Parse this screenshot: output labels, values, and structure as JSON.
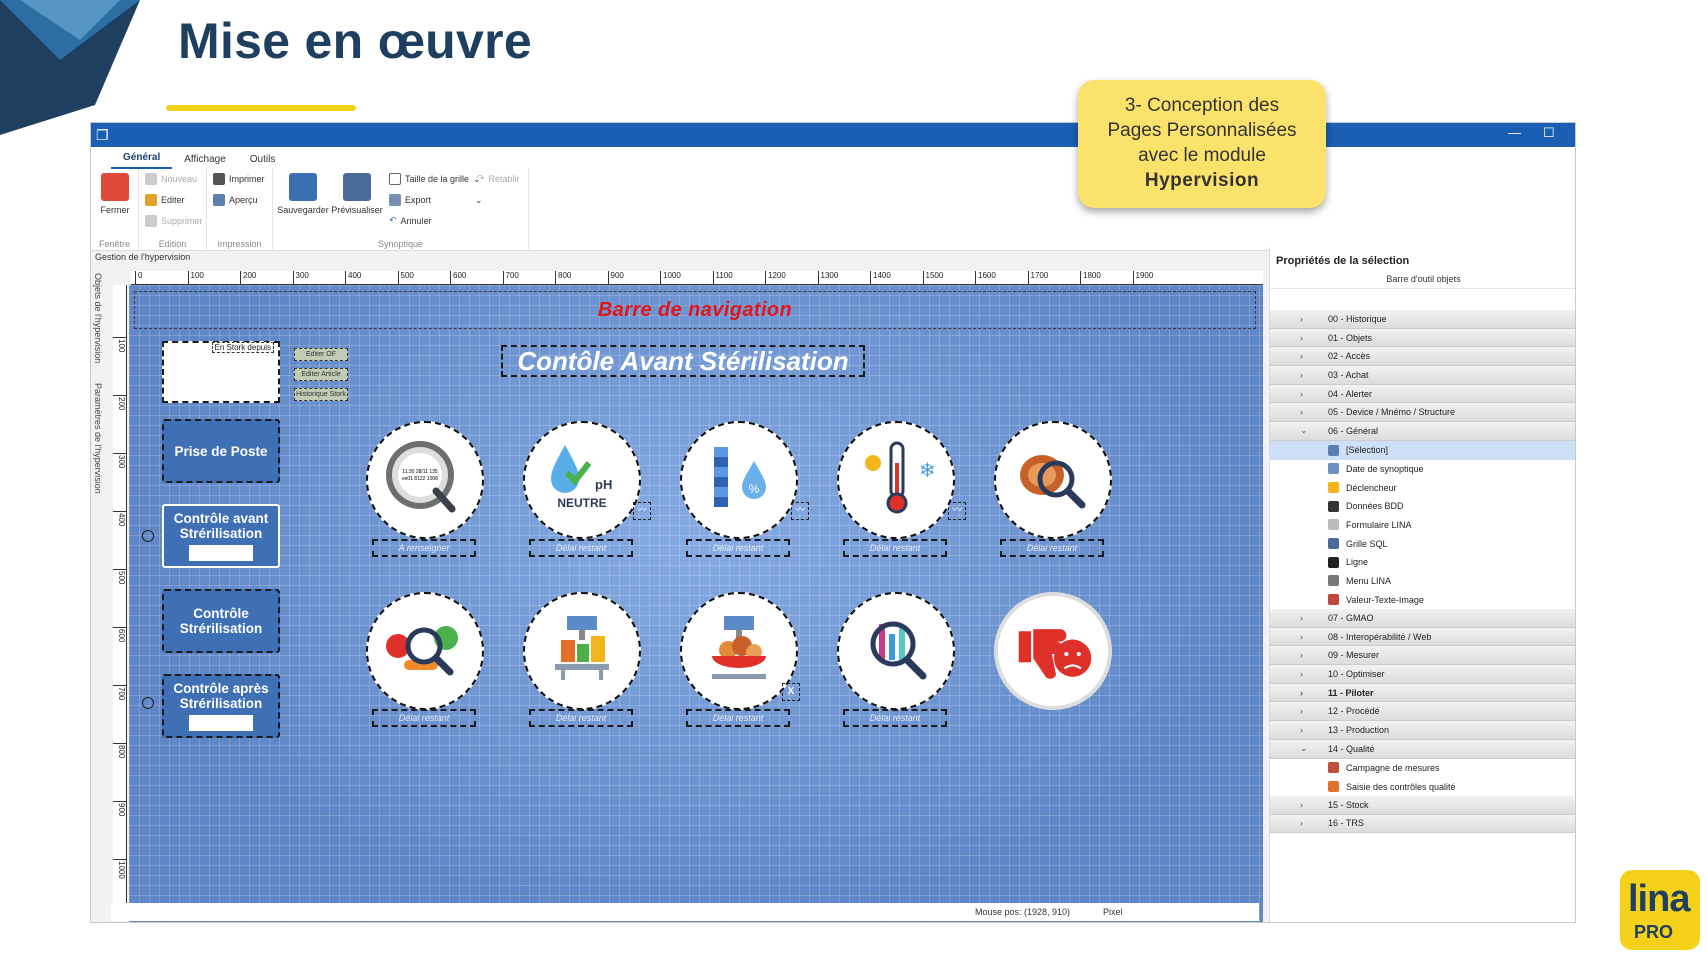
{
  "slide": {
    "title": "Mise en œuvre",
    "callout_line1": "3- Conception des",
    "callout_line2": "Pages Personnalisées",
    "callout_line3": "avec le module",
    "callout_bold": "Hypervision",
    "logo_text": "lina",
    "logo_sub": "PRO",
    "colors": {
      "title": "#1e3f5f",
      "accent_yellow": "#f3d21a",
      "titlebar": "#1a5fb4"
    }
  },
  "app": {
    "tabs": [
      "Général",
      "Affichage",
      "Outils"
    ],
    "ribbon": {
      "fenetre": {
        "fermer": "Fermer",
        "group": "Fenêtre"
      },
      "edition": {
        "nouveau": "Nouveau",
        "editer": "Editer",
        "supprimer": "Supprimer",
        "group": "Edition"
      },
      "impression": {
        "imprimer": "Imprimer",
        "apercu": "Aperçu",
        "group": "Impression"
      },
      "synoptique": {
        "sauvegarder": "Sauvegarder",
        "previsualiser": "Prévisualiser",
        "taille": "Taille de la grille",
        "retablir": "Rétablir",
        "export": "Export",
        "annuler": "Annuler",
        "group": "Synoptique"
      }
    },
    "breadcrumb": "Gestion de l'hypervision",
    "side_labels": [
      "Objets de l'hypervision",
      "Paramètres de l'hypervision"
    ],
    "hruler": [
      "0",
      "100",
      "200",
      "300",
      "400",
      "500",
      "600",
      "700",
      "800",
      "900",
      "1000",
      "1100",
      "1200",
      "1300",
      "1400",
      "1500",
      "1600",
      "1700",
      "1800",
      "1900"
    ],
    "vruler": [
      "100",
      "200",
      "300",
      "400",
      "500",
      "600",
      "700",
      "800",
      "900",
      "1000"
    ],
    "canvas": {
      "navbar": "Barre de navigation",
      "title": "Contôle Avant Stérilisation",
      "stock_label": "En Stork depuis",
      "small_buttons": [
        "Editer OF",
        "Editer Article",
        "Historique Stork"
      ],
      "nav_buttons": [
        "Prise de Poste",
        "Contrôle avant Strérilisation",
        "Contrôle Strérilisation",
        "Contrôle après Strérilisation"
      ],
      "labels_row1": [
        "A renseigner",
        "Délai restant",
        "Délai restant",
        "Délai restant",
        "Délai restant"
      ],
      "labels_row2": [
        "Délai restant",
        "Délai restant",
        "Délai restant",
        "Délai restant"
      ],
      "ph_text": "pH",
      "neutre_text": "NEUTRE",
      "watch_text": "11:30 28/11 135",
      "watch_text2": "ex01 8122 1008",
      "x_mark": "X",
      "percent": "%"
    },
    "status": {
      "mouse": "Mouse pos: (1928, 910)",
      "unit": "Pixel"
    },
    "props": {
      "title": "Propriétés de la sélection",
      "subtitle": "Barre d'outil objets",
      "tree": [
        {
          "label": "00 - Historique",
          "type": "cat"
        },
        {
          "label": "01 - Objets",
          "type": "cat"
        },
        {
          "label": "02 - Accès",
          "type": "cat"
        },
        {
          "label": "03 - Achat",
          "type": "cat"
        },
        {
          "label": "04 - Alerter",
          "type": "cat"
        },
        {
          "label": "05 - Device / Mnémo / Structure",
          "type": "cat"
        },
        {
          "label": "06 - Général",
          "type": "cat",
          "open": true
        },
        {
          "label": "[Sélection]",
          "type": "child",
          "selected": true,
          "color": "#5a7fb4"
        },
        {
          "label": "Date de synoptique",
          "type": "child",
          "color": "#6a8fc0"
        },
        {
          "label": "Déclencheur",
          "type": "child",
          "color": "#f2b51a"
        },
        {
          "label": "Données BDD",
          "type": "child",
          "color": "#333"
        },
        {
          "label": "Formulaire LINA",
          "type": "child",
          "color": "#bbb"
        },
        {
          "label": "Grille SQL",
          "type": "child",
          "color": "#4a6a9a"
        },
        {
          "label": "Ligne",
          "type": "child",
          "color": "#222"
        },
        {
          "label": "Menu LINA",
          "type": "child",
          "color": "#777"
        },
        {
          "label": "Valeur-Texte-Image",
          "type": "child",
          "color": "#c04a3a"
        },
        {
          "label": "07 - GMAO",
          "type": "cat"
        },
        {
          "label": "08 - Interopérabilité / Web",
          "type": "cat"
        },
        {
          "label": "09 - Mesurer",
          "type": "cat"
        },
        {
          "label": "10 - Optimiser",
          "type": "cat"
        },
        {
          "label": "11 - Piloter",
          "type": "cat",
          "bold": true
        },
        {
          "label": "12 - Procédé",
          "type": "cat"
        },
        {
          "label": "13 - Production",
          "type": "cat"
        },
        {
          "label": "14 - Qualité",
          "type": "cat",
          "open": true
        },
        {
          "label": "Campagne de mesures",
          "type": "child",
          "color": "#c0503a"
        },
        {
          "label": "Saisie des contrôles qualité",
          "type": "child",
          "color": "#e0702a"
        },
        {
          "label": "15 - Stock",
          "type": "cat"
        },
        {
          "label": "16 - TRS",
          "type": "cat"
        }
      ]
    }
  }
}
